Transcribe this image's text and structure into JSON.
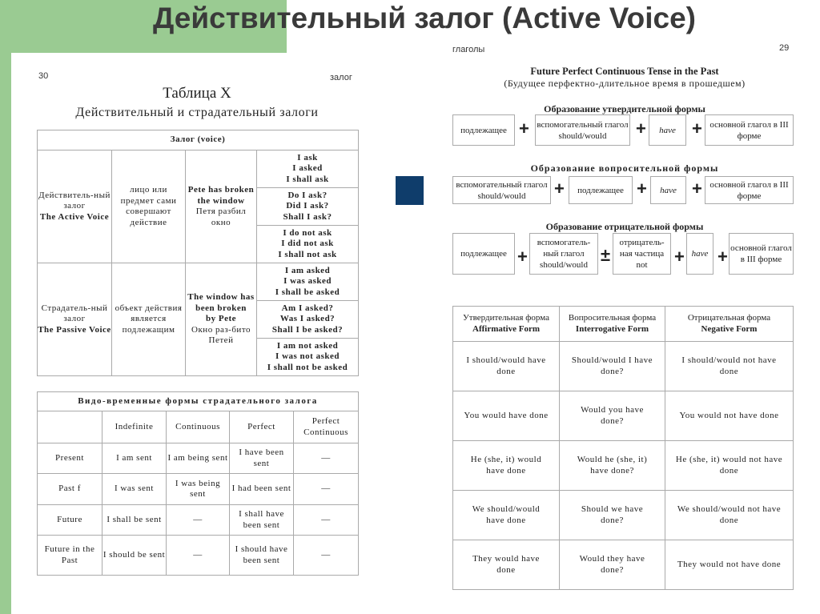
{
  "title": "Действительный залог (Active Voice)",
  "accent_color": "#9acb92",
  "marker_color": "#0f3d6b",
  "left_page": {
    "page_number": "30",
    "running_head": "залог",
    "table_title": "Таблица X",
    "table_subtitle": "Действительный и страдательный залоги",
    "voice_table": {
      "header": "Залог (voice)",
      "rows": [
        {
          "name": "Действитель-ный залог",
          "name_en": "The Active Voice",
          "meaning": "лицо или предмет сами совершают действие",
          "example": "Pete has broken the window",
          "example_ru": "Петя разбил окно",
          "forms": [
            "I ask\nI asked\nI shall ask",
            "Do I ask?\nDid I ask?\nShall I ask?",
            "I do not ask\nI did not ask\nI shall not ask"
          ]
        },
        {
          "name": "Страдатель-ный залог",
          "name_en": "The Passive Voice",
          "meaning": "объект действия является подлежащим",
          "example": "The window has been broken",
          "example_by": "by Pete",
          "example_ru": "Окно раз-бито Петей",
          "forms": [
            "I am asked\nI was asked\nI shall be asked",
            "Am I asked?\nWas I asked?\nShall I be asked?",
            "I am not asked\nI was not asked\nI shall not be asked"
          ]
        }
      ]
    },
    "passive_table": {
      "title": "Видо-временные формы страдательного залога",
      "columns": [
        "",
        "Indefinite",
        "Continuous",
        "Perfect",
        "Perfect Continuous"
      ],
      "rows": [
        [
          "Present",
          "I am sent",
          "I am being sent",
          "I have been sent",
          "—"
        ],
        [
          "Past f",
          "I was sent",
          "I was being sent",
          "I had been sent",
          "—"
        ],
        [
          "Future",
          "I shall be sent",
          "—",
          "I shall have been sent",
          "—"
        ],
        [
          "Future in the Past",
          "I should be sent",
          "—",
          "I should have been sent",
          "—"
        ]
      ]
    }
  },
  "right_page": {
    "running_head": "глаголы",
    "page_number": "29",
    "heading": "Future Perfect Continuous Tense in the Past",
    "subheading": "(Будущее перфектно-длительное время в прошедшем)",
    "affirmative": {
      "title": "Образование утвердительной формы",
      "boxes": [
        "подлежащее",
        "вспомогательный глагол should/would",
        "have",
        "основной глагол в III форме"
      ]
    },
    "interrogative": {
      "title": "Образование вопросительной формы",
      "boxes": [
        "вспомогательный глагол should/would",
        "подлежащее",
        "have",
        "основной глагол в III форме"
      ]
    },
    "negative": {
      "title": "Образование отрицательной формы",
      "boxes": [
        "подлежащее",
        "вспомогатель-ный глагол should/would",
        "отрицатель-ная частица not",
        "have",
        "основной глагол в III форме"
      ]
    },
    "forms_table": {
      "columns": [
        {
          "ru": "Утвердительная форма",
          "en": "Affirmative Form"
        },
        {
          "ru": "Вопросительная форма",
          "en": "Interrogative Form"
        },
        {
          "ru": "Отрицательная форма",
          "en": "Negative Form"
        }
      ],
      "rows": [
        [
          "I should/would have done",
          "Should/would I have done?",
          "I should/would not have done"
        ],
        [
          "You would have done",
          "Would you have done?",
          "You would not have done"
        ],
        [
          "He (she, it) would have done",
          "Would he (she, it) have done?",
          "He (she, it) would not have done"
        ],
        [
          "We should/would have done",
          "Should we have done?",
          "We should/would not have done"
        ],
        [
          "They would have done",
          "Would they have done?",
          "They would not have done"
        ]
      ]
    }
  }
}
